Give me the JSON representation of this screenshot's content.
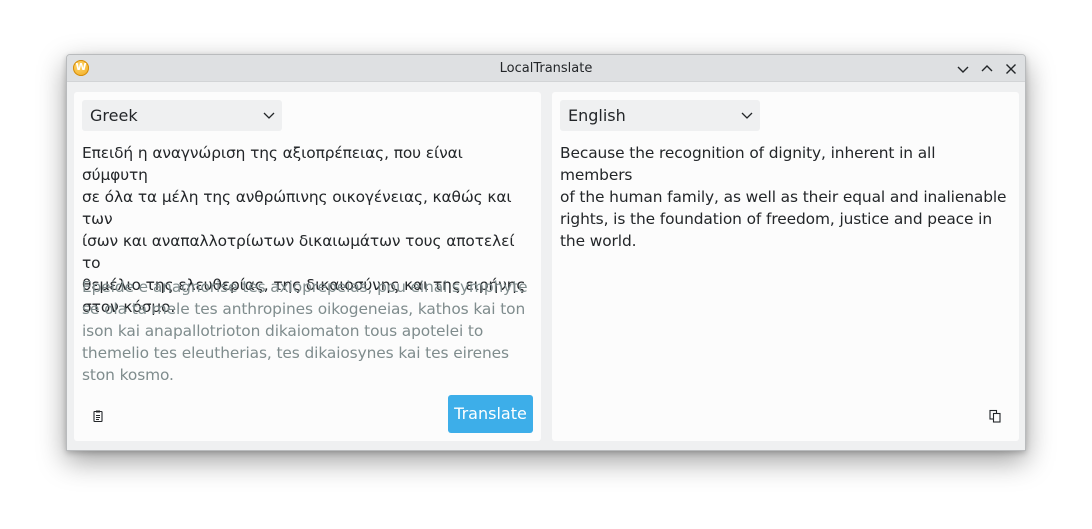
{
  "window": {
    "title": "LocalTranslate",
    "app_icon": "W",
    "controls": [
      "minimize-icon",
      "maximize-icon",
      "close-icon"
    ]
  },
  "source_panel": {
    "language": "Greek",
    "text": "Επειδή η αναγνώριση της αξιοπρέπειας, που είναι σύμφυτη\nσε όλα τα μέλη της ανθρώπινης οικογένειας, καθώς και των\nίσων και αναπαλλοτρίωτων δικαιωμάτων τους αποτελεί το\nθεμέλιο της ελευθερίας, της δικαιοσύνης και της ειρήνης\nστον κόσμο.",
    "transliteration": "Epeide e anagnorise tes axioprepeias, pou einai symphyte\nse ola ta mele tes anthropines oikogeneias, kathos kai ton\nison kai anapallotrioton dikaiomaton tous apotelei to\nthemelio tes eleutherias, tes dikaiosynes kai tes eirenes\nston kosmo.",
    "paste_icon": "clipboard-icon",
    "translate_label": "Translate"
  },
  "target_panel": {
    "language": "English",
    "text": "Because the recognition of dignity, inherent in all members\nof the human family, as well as their equal and inalienable\nrights, is the foundation of freedom, justice and peace in\nthe world.",
    "copy_icon": "copy-icon"
  },
  "colors": {
    "accent": "#3daee9",
    "window_bg": "#eff0f1",
    "panel_bg": "#fcfcfc",
    "text": "#232629",
    "muted_text": "#7f8c8d",
    "app_icon": "#f0a81c"
  }
}
